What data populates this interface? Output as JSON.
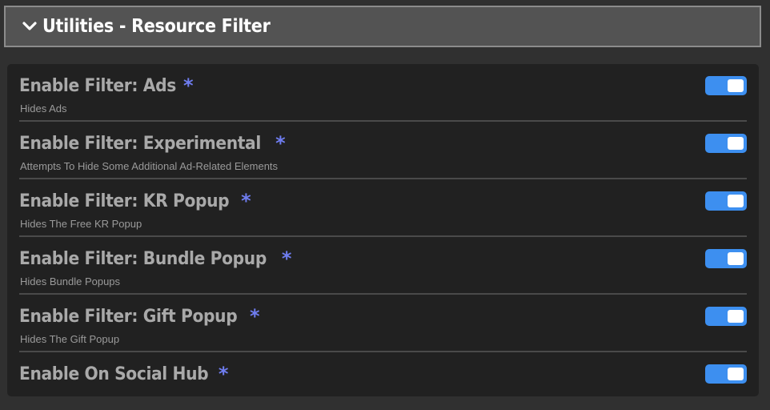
{
  "header": {
    "title": "Utilities - Resource Filter",
    "icon": "chevron-down-icon"
  },
  "colors": {
    "accent": "#3d8ff0",
    "asterisk": "#6f7df0",
    "panel_bg": "#212121",
    "header_bg": "#535353"
  },
  "settings": [
    {
      "label": "Enable Filter: Ads",
      "marker": "*",
      "description": "Hides Ads",
      "enabled": true
    },
    {
      "label": "Enable Filter: Experimental",
      "marker": "*",
      "description": "Attempts To Hide Some Additional Ad-Related Elements",
      "enabled": true
    },
    {
      "label": "Enable Filter: KR Popup",
      "marker": "*",
      "description": "Hides The Free KR Popup",
      "enabled": true
    },
    {
      "label": "Enable Filter: Bundle Popup",
      "marker": "*",
      "description": "Hides Bundle Popups",
      "enabled": true
    },
    {
      "label": "Enable Filter: Gift Popup",
      "marker": "*",
      "description": "Hides The Gift Popup",
      "enabled": true
    },
    {
      "label": "Enable On Social Hub",
      "marker": "*",
      "description": "",
      "enabled": true
    }
  ]
}
